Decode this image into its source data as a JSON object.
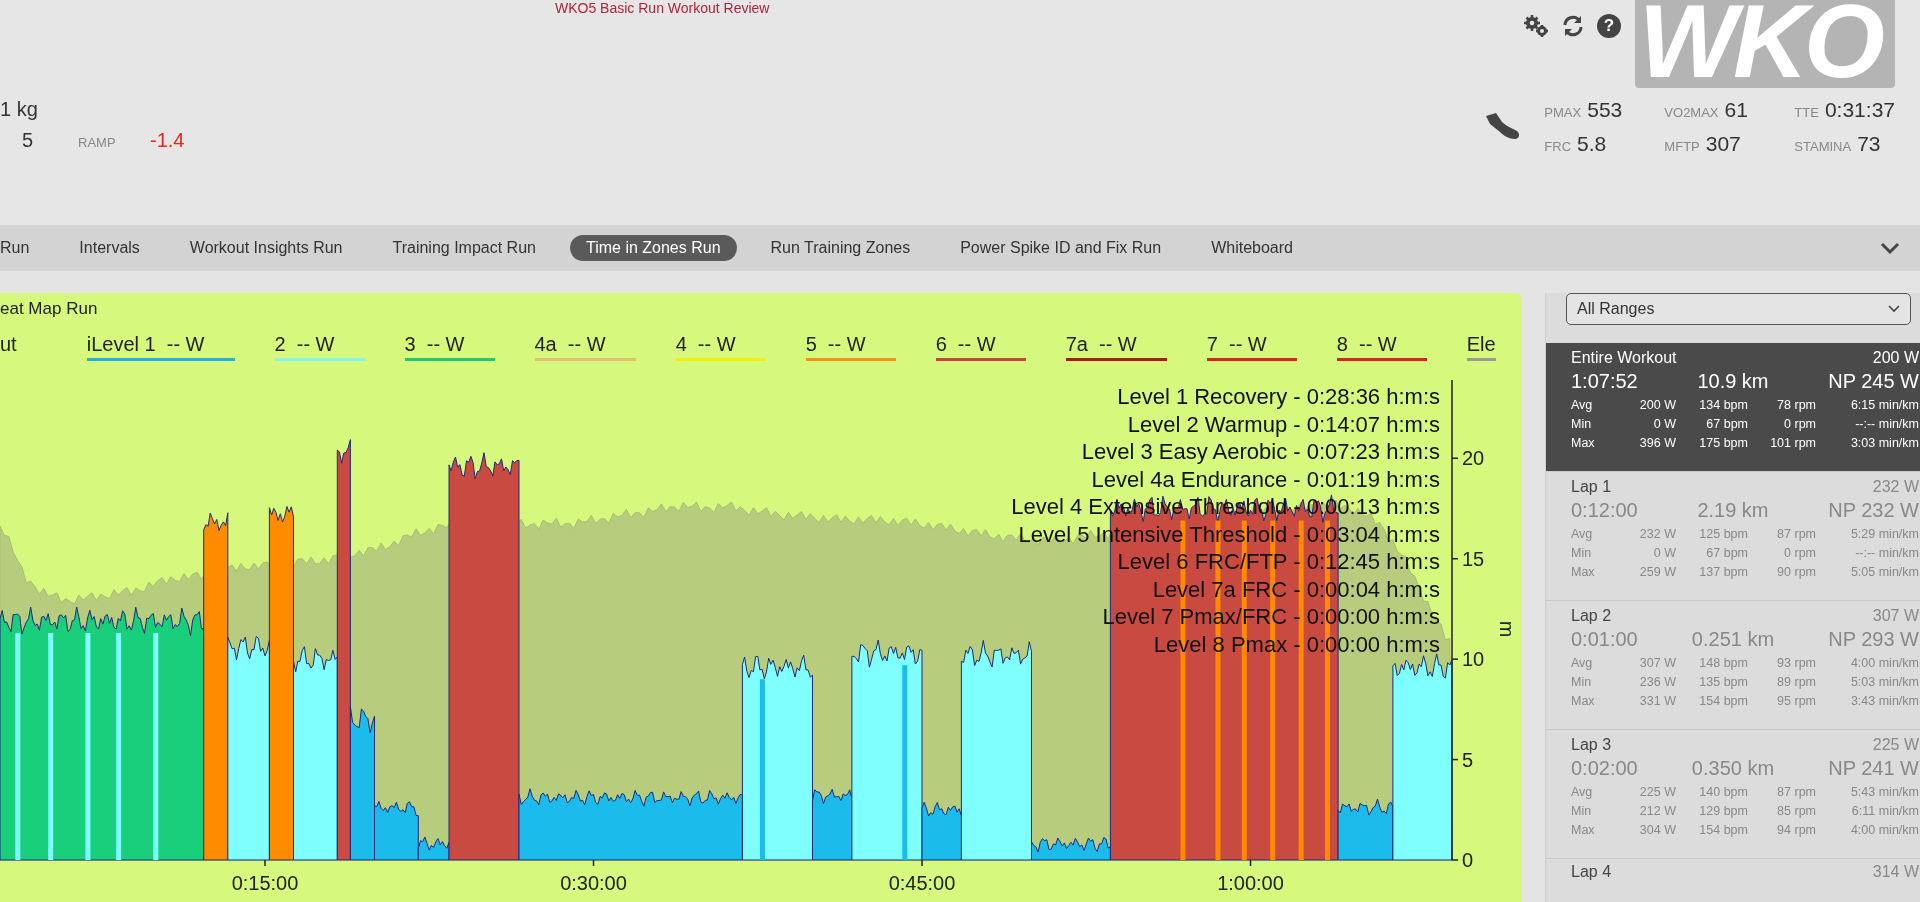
{
  "header": {
    "title": "WKO5 Basic Run Workout Review",
    "athlete": {
      "weight": "1 kg",
      "value": "5",
      "ramp_label": "RAMP",
      "ramp_value": "-1.4"
    },
    "help_glyph": "?",
    "logo": "WKO",
    "metrics": [
      {
        "label": "PMAX",
        "value": "553"
      },
      {
        "label": "VO2MAX",
        "value": "61"
      },
      {
        "label": "TTE",
        "value": "0:31:37"
      },
      {
        "label": "FRC",
        "value": "5.8"
      },
      {
        "label": "MFTP",
        "value": "307"
      },
      {
        "label": "STAMINA",
        "value": "73"
      }
    ]
  },
  "tabs": [
    {
      "label": "Run",
      "selected": false
    },
    {
      "label": "Intervals",
      "selected": false
    },
    {
      "label": "Workout Insights Run",
      "selected": false
    },
    {
      "label": "Training Impact Run",
      "selected": false
    },
    {
      "label": "Time in Zones Run",
      "selected": true
    },
    {
      "label": "Run Training Zones",
      "selected": false
    },
    {
      "label": "Power Spike ID and Fix Run",
      "selected": false
    },
    {
      "label": "Whiteboard",
      "selected": false
    }
  ],
  "chart_panel": {
    "title": "eat Map Run",
    "legend": [
      {
        "label": "ut"
      },
      {
        "label": "iLevel 1  -- W",
        "color": "#1fb4e6"
      },
      {
        "label": "2  -- W",
        "color": "#7ff7f7"
      },
      {
        "label": "3  -- W",
        "color": "#1fc97a"
      },
      {
        "label": "4a  -- W",
        "color": "#e0c070"
      },
      {
        "label": "4  -- W",
        "color": "#f2f200"
      },
      {
        "label": "5  -- W",
        "color": "#ff8c1a"
      },
      {
        "label": "6  -- W",
        "color": "#d04040"
      },
      {
        "label": "7a  -- W",
        "color": "#b01818"
      },
      {
        "label": "7  -- W",
        "color": "#e02020"
      },
      {
        "label": "8  -- W",
        "color": "#e02020"
      },
      {
        "label": "Ele",
        "color": "#9a9a9a"
      }
    ],
    "zone_totals": [
      "Level 1 Recovery - 0:28:36 h:m:s",
      "Level 2 Warmup - 0:14:07 h:m:s",
      "Level 3 Easy Aerobic - 0:07:23 h:m:s",
      "Level 4a Endurance - 0:01:19 h:m:s",
      "Level 4 Extensive Threshold - 0:00:13 h:m:s",
      "Level 5 Intensive Threshold - 0:03:04 h:m:s",
      "Level 6 FRC/FTP - 0:12:45 h:m:s",
      "Level 7a FRC - 0:00:04 h:m:s",
      "Level 7 Pmax/FRC - 0:00:00 h:m:s",
      "Level 8 Pmax - 0:00:00 h:m:s"
    ],
    "x_tick_labels": [
      "0:15:00",
      "0:30:00",
      "0:45:00",
      "1:00:00"
    ],
    "y_tick_labels": [
      "20",
      "15",
      "10",
      "5",
      "0"
    ],
    "y_axis_title": "m"
  },
  "sidebar": {
    "range_select": "All Ranges",
    "ranges": [
      {
        "title": "Entire Workout",
        "power": "200 W",
        "time": "1:07:52",
        "distance": "10.9 km",
        "np": "NP 245 W",
        "selected": true,
        "stats": [
          [
            "Avg",
            "200 W",
            "134 bpm",
            "78 rpm",
            "6:15 min/km"
          ],
          [
            "Min",
            "0 W",
            "67 bpm",
            "0 rpm",
            "--:-- min/km"
          ],
          [
            "Max",
            "396 W",
            "175 bpm",
            "101 rpm",
            "3:03 min/km"
          ]
        ]
      },
      {
        "title": "Lap 1",
        "power": "232 W",
        "time": "0:12:00",
        "distance": "2.19 km",
        "np": "NP 232 W",
        "selected": false,
        "stats": [
          [
            "Avg",
            "232 W",
            "125 bpm",
            "87 rpm",
            "5:29 min/km"
          ],
          [
            "Min",
            "0 W",
            "67 bpm",
            "0 rpm",
            "--:-- min/km"
          ],
          [
            "Max",
            "259 W",
            "137 bpm",
            "90 rpm",
            "5:05 min/km"
          ]
        ]
      },
      {
        "title": "Lap 2",
        "power": "307 W",
        "time": "0:01:00",
        "distance": "0.251 km",
        "np": "NP 293 W",
        "selected": false,
        "stats": [
          [
            "Avg",
            "307 W",
            "148 bpm",
            "93 rpm",
            "4:00 min/km"
          ],
          [
            "Min",
            "236 W",
            "135 bpm",
            "89 rpm",
            "5:03 min/km"
          ],
          [
            "Max",
            "331 W",
            "154 bpm",
            "95 rpm",
            "3:43 min/km"
          ]
        ]
      },
      {
        "title": "Lap 3",
        "power": "225 W",
        "time": "0:02:00",
        "distance": "0.350 km",
        "np": "NP 241 W",
        "selected": false,
        "stats": [
          [
            "Avg",
            "225 W",
            "140 bpm",
            "87 rpm",
            "5:43 min/km"
          ],
          [
            "Min",
            "212 W",
            "129 bpm",
            "85 rpm",
            "6:11 min/km"
          ],
          [
            "Max",
            "304 W",
            "154 bpm",
            "94 rpm",
            "4:00 min/km"
          ]
        ]
      },
      {
        "title": "Lap 4",
        "power": "314 W",
        "selected": false
      }
    ]
  }
}
